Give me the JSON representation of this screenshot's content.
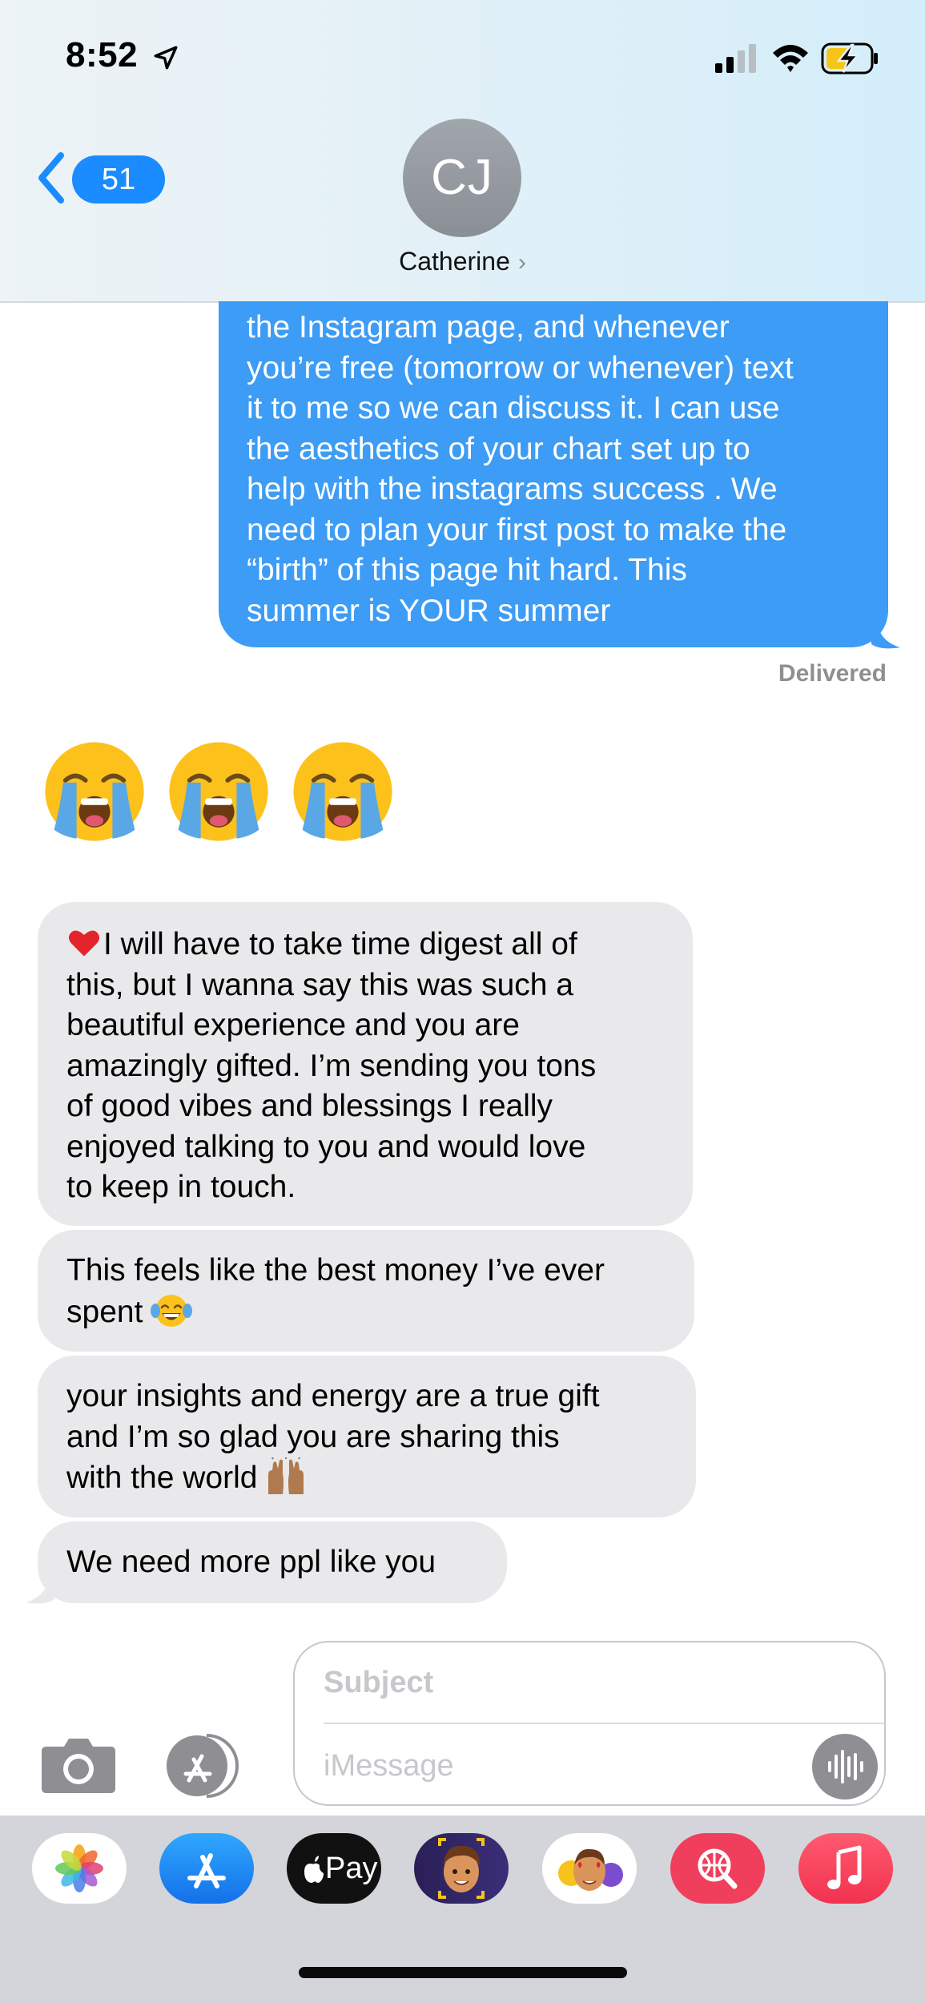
{
  "status_bar": {
    "time": "8:52",
    "icons": [
      "location-arrow-icon",
      "signal-icon",
      "wifi-icon",
      "battery-charging-icon"
    ]
  },
  "header": {
    "back_badge": "51",
    "avatar_initials": "CJ",
    "contact_name": "Catherine",
    "chevron": "›"
  },
  "messages": {
    "sent": [
      "the Instagram page, and whenever",
      "you’re free (tomorrow or whenever) text",
      "it to me so we can discuss it. I can use",
      "the aesthetics of your chart set up to",
      "help with the instagrams success . We",
      "need to plan your first post to make the",
      "“birth” of this page hit hard. This",
      "summer is YOUR summer"
    ],
    "delivered": "Delivered",
    "emoji_reaction": [
      "loudly-crying-face",
      "loudly-crying-face",
      "loudly-crying-face"
    ],
    "received_1": [
      "I will have to take time digest all of",
      "this, but I wanna say this was such a",
      "beautiful experience and you are",
      "amazingly gifted. I’m sending you tons",
      "of good vibes and blessings I really",
      "enjoyed talking to you and would love",
      "to keep in touch."
    ],
    "received_2": [
      "This feels like the best money I’ve ever",
      "spent"
    ],
    "received_3": [
      "your insights and energy are a true gift",
      "and I’m so glad you are sharing this",
      "with the world"
    ],
    "received_4": "We need more ppl like you"
  },
  "compose": {
    "subject_placeholder": "Subject",
    "message_placeholder": "iMessage"
  },
  "app_drawer": {
    "apps": [
      "photos-app",
      "app-store-app",
      "apple-pay-app",
      "memoji-app",
      "animoji-stickers-app",
      "web-images-search-app",
      "music-app"
    ],
    "apple_pay_label": "Pay"
  },
  "colors": {
    "sent_bubble": "#3d9cf5",
    "received_bubble": "#e9e9eb",
    "badge": "#1a8cff",
    "drawer": "#d3d5da"
  }
}
